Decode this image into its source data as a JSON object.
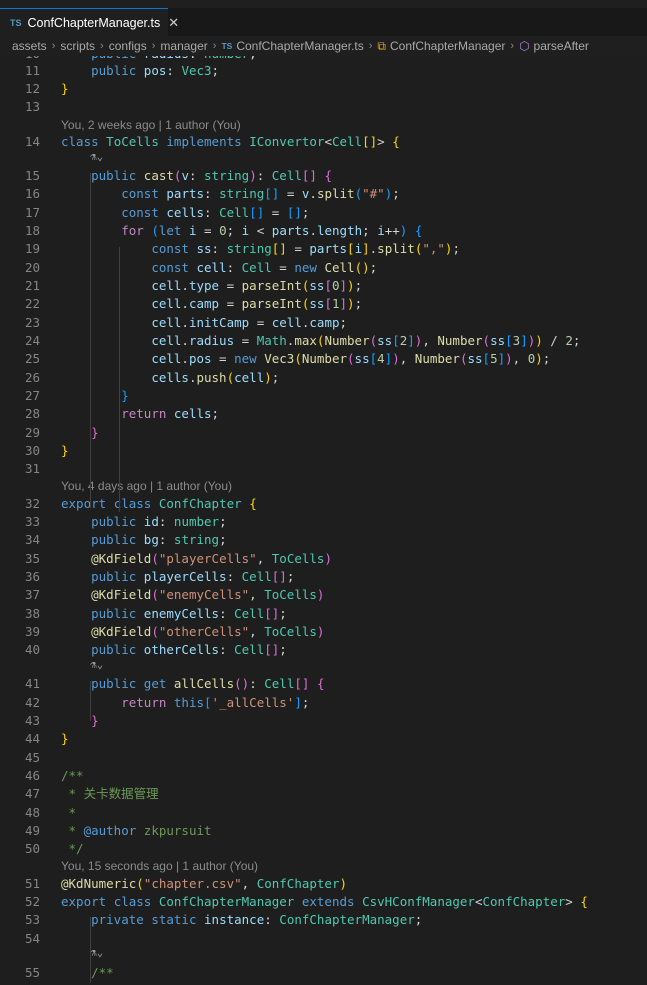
{
  "tab": {
    "badge": "TS",
    "title": "ConfChapterManager.ts",
    "close": "✕"
  },
  "breadcrumb": {
    "items": [
      "assets",
      "scripts",
      "configs",
      "manager",
      "ConfChapterManager.ts",
      "ConfChapterManager",
      "parseAfter"
    ],
    "file_badge": "TS"
  },
  "codelens": [
    "You, 2 weeks ago | 1 author (You)",
    "You, 4 days ago | 1 author (You)",
    "You, 15 seconds ago | 1 author (You)"
  ],
  "inline_hint": "⚗⌄",
  "partial_line": "    public radius: number;",
  "lines": [
    {
      "n": "11",
      "text": "    public pos: Vec3;"
    },
    {
      "n": "12",
      "text": "}"
    },
    {
      "n": "13",
      "text": ""
    },
    {
      "n": "14",
      "text": "class ToCells implements IConvertor<Cell[]> {"
    },
    {
      "n": "15",
      "text": "    public cast(v: string): Cell[] {"
    },
    {
      "n": "16",
      "text": "        const parts: string[] = v.split(\"#\");"
    },
    {
      "n": "17",
      "text": "        const cells: Cell[] = [];"
    },
    {
      "n": "18",
      "text": "        for (let i = 0; i < parts.length; i++) {"
    },
    {
      "n": "19",
      "text": "            const ss: string[] = parts[i].split(\",\");"
    },
    {
      "n": "20",
      "text": "            const cell: Cell = new Cell();"
    },
    {
      "n": "21",
      "text": "            cell.type = parseInt(ss[0]);"
    },
    {
      "n": "22",
      "text": "            cell.camp = parseInt(ss[1]);"
    },
    {
      "n": "23",
      "text": "            cell.initCamp = cell.camp;"
    },
    {
      "n": "24",
      "text": "            cell.radius = Math.max(Number(ss[2]), Number(ss[3])) / 2;"
    },
    {
      "n": "25",
      "text": "            cell.pos = new Vec3(Number(ss[4]), Number(ss[5]), 0);"
    },
    {
      "n": "26",
      "text": "            cells.push(cell);"
    },
    {
      "n": "27",
      "text": "        }"
    },
    {
      "n": "28",
      "text": "        return cells;"
    },
    {
      "n": "29",
      "text": "    }"
    },
    {
      "n": "30",
      "text": "}"
    },
    {
      "n": "31",
      "text": ""
    },
    {
      "n": "32",
      "text": "export class ConfChapter {"
    },
    {
      "n": "33",
      "text": "    public id: number;"
    },
    {
      "n": "34",
      "text": "    public bg: string;"
    },
    {
      "n": "35",
      "text": "    @KdField(\"playerCells\", ToCells)"
    },
    {
      "n": "36",
      "text": "    public playerCells: Cell[];"
    },
    {
      "n": "37",
      "text": "    @KdField(\"enemyCells\", ToCells)"
    },
    {
      "n": "38",
      "text": "    public enemyCells: Cell[];"
    },
    {
      "n": "39",
      "text": "    @KdField(\"otherCells\", ToCells)"
    },
    {
      "n": "40",
      "text": "    public otherCells: Cell[];"
    },
    {
      "n": "41",
      "text": "    public get allCells(): Cell[] {"
    },
    {
      "n": "42",
      "text": "        return this['_allCells'];"
    },
    {
      "n": "43",
      "text": "    }"
    },
    {
      "n": "44",
      "text": "}"
    },
    {
      "n": "45",
      "text": ""
    },
    {
      "n": "46",
      "text": "/**"
    },
    {
      "n": "47",
      "text": " * 关卡数据管理"
    },
    {
      "n": "48",
      "text": " *"
    },
    {
      "n": "49",
      "text": " * @author zkpursuit"
    },
    {
      "n": "50",
      "text": " */"
    },
    {
      "n": "51",
      "text": "@KdNumeric(\"chapter.csv\", ConfChapter)"
    },
    {
      "n": "52",
      "text": "export class ConfChapterManager extends CsvHConfManager<ConfChapter> {"
    },
    {
      "n": "53",
      "text": "    private static instance: ConfChapterManager;"
    },
    {
      "n": "54",
      "text": ""
    },
    {
      "n": "55",
      "text": "    /**"
    }
  ],
  "colors": {
    "editor_bg": "#1e1e1e",
    "keyword": "#569cd6",
    "control": "#c586c0",
    "function": "#dcdcaa",
    "type": "#4ec9b0",
    "variable": "#9cdcfe",
    "string": "#ce9178",
    "number": "#b5cea8",
    "comment": "#6a9955"
  }
}
